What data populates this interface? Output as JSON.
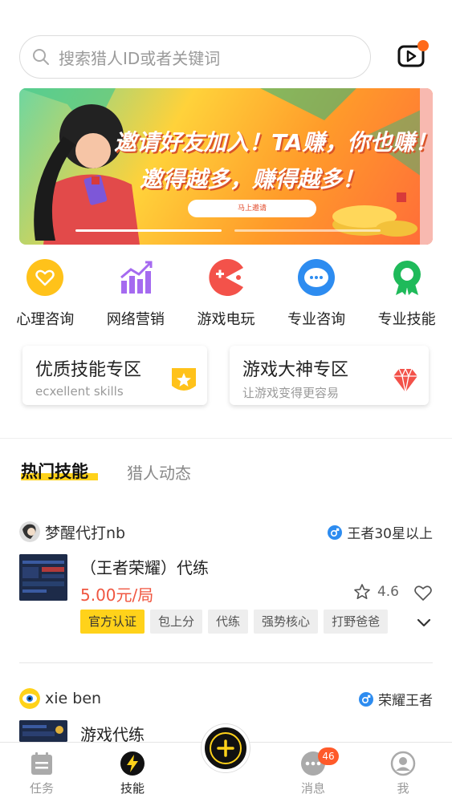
{
  "search": {
    "placeholder": "搜索猎人ID或者关键词",
    "video_badge": true
  },
  "banner": {
    "line1": "邀请好友加入！TA赚，你也赚！",
    "line2": "邀得越多，赚得越多！",
    "button_label": "马上邀请",
    "slide_count": 2,
    "active_slide": 1
  },
  "categories": [
    {
      "label": "心理咨询",
      "icon": "heart-icon",
      "color": "#ffc21a"
    },
    {
      "label": "网络营销",
      "icon": "chart-icon",
      "color": "#a56af0"
    },
    {
      "label": "游戏电玩",
      "icon": "pacman-icon",
      "color": "#f3524a"
    },
    {
      "label": "专业咨询",
      "icon": "chat-bubble-icon",
      "color": "#2d8cf0"
    },
    {
      "label": "专业技能",
      "icon": "badge-icon",
      "color": "#1fba5a"
    }
  ],
  "zones": [
    {
      "title": "优质技能专区",
      "subtitle": "ecxellent skills",
      "icon": "star-badge-icon"
    },
    {
      "title": "游戏大神专区",
      "subtitle": "让游戏变得更容易",
      "icon": "diamond-icon"
    }
  ],
  "tabs": {
    "active": "热门技能",
    "inactive": "猎人动态"
  },
  "listings": [
    {
      "user": "梦醒代打nb",
      "rank": "王者30星以上",
      "title": "（王者荣耀）代练",
      "price": "5.00元/局",
      "rating": "4.6",
      "tags": [
        "官方认证",
        "包上分",
        "代练",
        "强势核心",
        "打野爸爸"
      ]
    },
    {
      "user": "xie ben",
      "rank": "荣耀王者",
      "title": "游戏代练"
    }
  ],
  "nav": {
    "items": [
      {
        "label": "任务",
        "icon": "task-icon"
      },
      {
        "label": "技能",
        "icon": "lightning-icon"
      },
      {
        "label": "消息",
        "icon": "message-icon",
        "badge": "46"
      },
      {
        "label": "我",
        "icon": "profile-icon"
      }
    ],
    "active_index": 1
  },
  "colors": {
    "accent": "#ffd21a",
    "price": "#f05640",
    "male": "#2d8cf0",
    "badge": "#ff5a2a"
  }
}
